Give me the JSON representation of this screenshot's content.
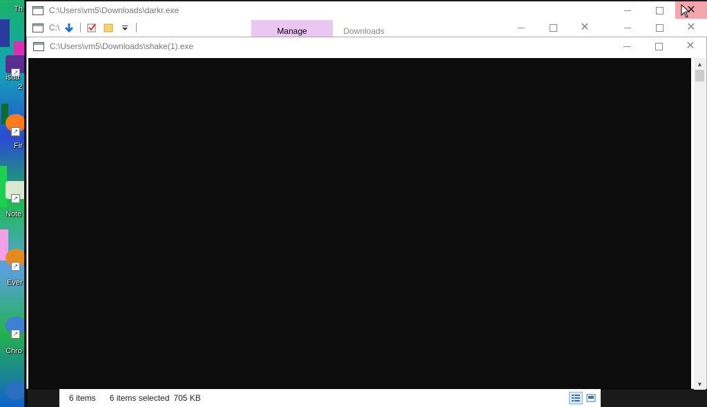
{
  "desktop": {
    "icons": [
      {
        "label": "Th",
        "icon": "desktop-app-icon"
      },
      {
        "label": "isua",
        "icon": "visual-studio-icon"
      },
      {
        "label": "2",
        "icon": ""
      },
      {
        "label": "Fir",
        "icon": "firefox-icon"
      },
      {
        "label": "Note",
        "icon": "notepad-icon"
      },
      {
        "label": "Ever",
        "icon": "everything-icon"
      },
      {
        "label": "Chro",
        "icon": "chrome-icon"
      }
    ]
  },
  "windows": {
    "back": {
      "title": "C:\\Users\\vm5\\Downloads\\darkr.exe",
      "close_highlight": "#f3a6aa"
    },
    "explorer": {
      "title_partial": "C:\\",
      "ribbon_tabs": [
        {
          "label": "Manage",
          "color": "#ecc6f2"
        },
        {
          "label": "Downloads"
        }
      ],
      "quick_access_icons": [
        "properties-down-arrow-icon",
        "checkbox-icon",
        "new-folder-icon",
        "customize-dropdown-icon"
      ]
    },
    "console": {
      "title": "C:\\Users\\vm5\\Downloads\\shake(1).exe",
      "background": "#0c0c0c"
    }
  },
  "statusbar": {
    "item_count": "6 items",
    "selected": "6 items selected",
    "size": "705 KB",
    "views": [
      "details-view-icon",
      "large-icons-view-icon"
    ]
  }
}
